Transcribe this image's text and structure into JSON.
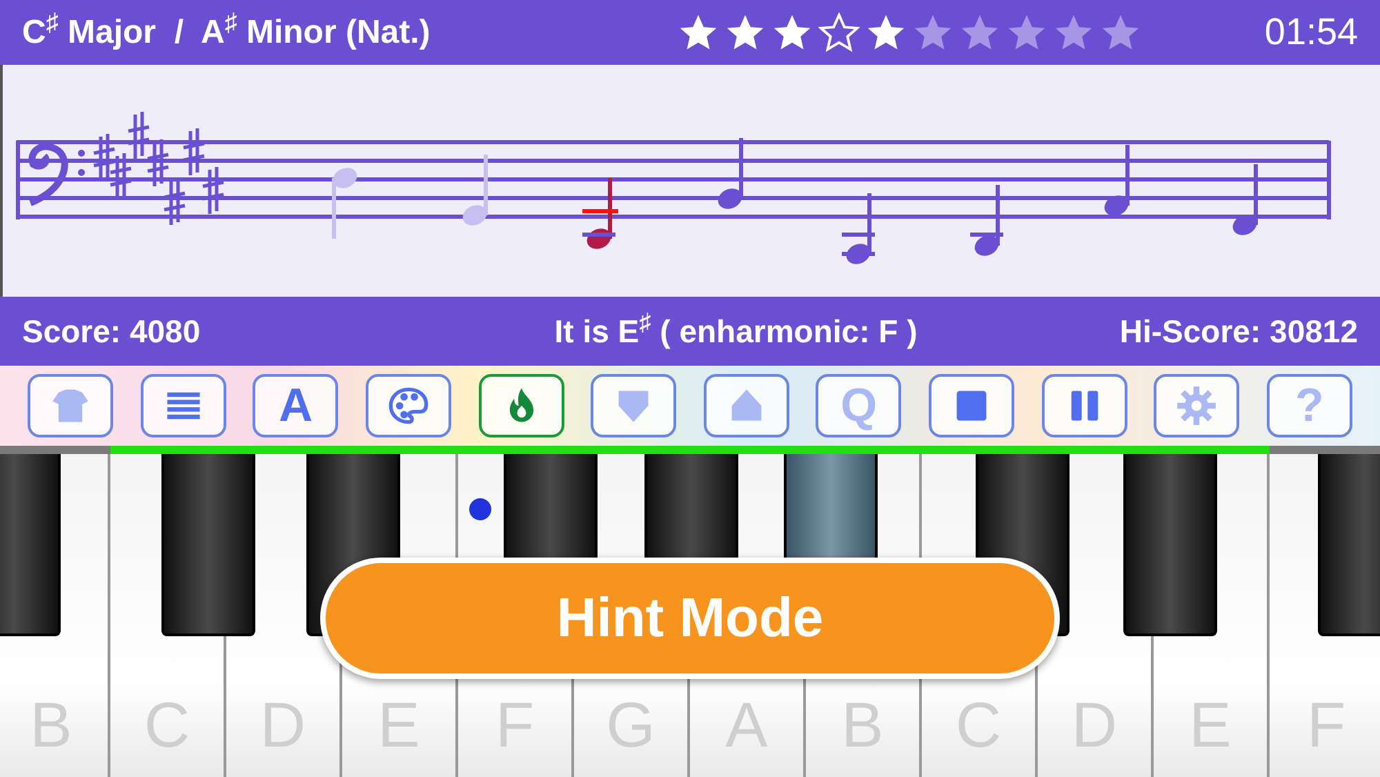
{
  "header": {
    "key": "C$^{♯}$ Major  /  A$^{♯}$ Minor (Nat.)",
    "time": "01:54"
  },
  "stars": [
    {
      "kind": "filled"
    },
    {
      "kind": "filled"
    },
    {
      "kind": "filled"
    },
    {
      "kind": "outline"
    },
    {
      "kind": "filled"
    },
    {
      "kind": "faded"
    },
    {
      "kind": "faded"
    },
    {
      "kind": "faded"
    },
    {
      "kind": "faded"
    },
    {
      "kind": "faded"
    }
  ],
  "notes": [
    {
      "kind": "played"
    },
    {
      "kind": "played"
    },
    {
      "kind": "current"
    },
    {
      "kind": "upcoming"
    },
    {
      "kind": "upcoming"
    },
    {
      "kind": "upcoming"
    },
    {
      "kind": "upcoming"
    },
    {
      "kind": "upcoming"
    }
  ],
  "info": {
    "score": "Score: 4080",
    "answer": "It is E$^{♯}$  ( enharmonic: F )",
    "hiscore": "Hi-Score: 30812"
  },
  "toolbar": [
    {
      "kind": "shirt",
      "disabled": true,
      "selected": false
    },
    {
      "kind": "lines",
      "disabled": false,
      "selected": false
    },
    {
      "kind": "letter",
      "label": "A",
      "disabled": false,
      "selected": false
    },
    {
      "kind": "palette",
      "disabled": false,
      "selected": false
    },
    {
      "kind": "flame",
      "disabled": false,
      "selected": true
    },
    {
      "kind": "down",
      "disabled": true,
      "selected": false
    },
    {
      "kind": "up",
      "disabled": true,
      "selected": false
    },
    {
      "kind": "letter",
      "label": "Q",
      "disabled": true,
      "selected": false
    },
    {
      "kind": "stop",
      "disabled": false,
      "selected": false
    },
    {
      "kind": "pause",
      "disabled": false,
      "selected": false
    },
    {
      "kind": "gear",
      "disabled": true,
      "selected": false
    },
    {
      "kind": "letter",
      "label": "?",
      "disabled": true,
      "selected": false
    }
  ],
  "white_keys": [
    {
      "label": "B"
    },
    {
      "label": "C"
    },
    {
      "label": "D"
    },
    {
      "label": "E"
    },
    {
      "label": "F"
    },
    {
      "label": "G"
    },
    {
      "label": "A"
    },
    {
      "label": "B"
    },
    {
      "label": "C"
    },
    {
      "label": "D"
    },
    {
      "label": "E"
    },
    {
      "label": "F"
    }
  ],
  "black_keys": [
    {
      "selected": false
    },
    {
      "selected": false
    },
    {
      "selected": false
    },
    {
      "selected": false
    },
    {
      "selected": false
    },
    {
      "selected": true
    },
    {
      "selected": false
    },
    {
      "selected": false
    },
    {
      "selected": false
    }
  ],
  "hint_button": "Hint Mode"
}
